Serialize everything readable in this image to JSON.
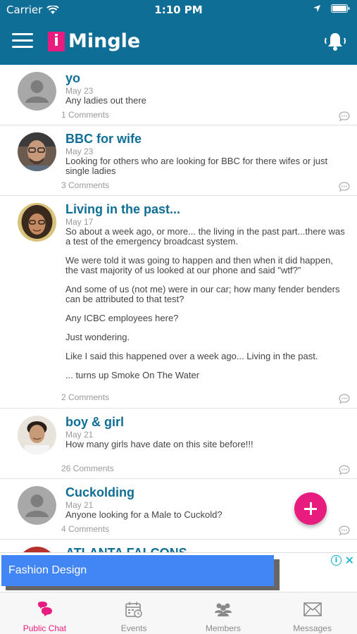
{
  "status_bar": {
    "carrier": "Carrier",
    "time": "1:10 PM"
  },
  "header": {
    "logo_letter": "i",
    "app_name": "Mingle"
  },
  "posts": [
    {
      "title": "yo",
      "date": "May 23",
      "body": [
        "Any ladies out there"
      ],
      "comments": "1 Comments",
      "avatar": "default-avatar"
    },
    {
      "title": "BBC for wife",
      "date": "May 23",
      "body": [
        "Looking for others who are looking for BBC for there wifes or just single ladies"
      ],
      "comments": "3 Comments",
      "avatar": "photo-man-glasses"
    },
    {
      "title": "Living in the past...",
      "date": "May 17",
      "body": [
        "So about a week ago, or more... the living in the past part...there was a test of the emergency broadcast system.",
        "We were told it was going to happen and then when it did happen, the vast majority of us looked at our phone and said \"wtf?\"",
        "And some of us (not me) were in our car; how many fender benders can be attributed to that test?",
        "Any ICBC employees here?",
        "Just wondering.",
        "Like I said this happened over a week ago... Living in the past.",
        "... turns up Smoke On The Water"
      ],
      "comments": "2 Comments",
      "avatar": "photo-curly-hair"
    },
    {
      "title": "boy & girl",
      "date": "May 21",
      "body": [
        "How many girls have date on this site before!!!"
      ],
      "comments": "26 Comments",
      "avatar": "photo-young-man"
    },
    {
      "title": "Cuckolding",
      "date": "May 21",
      "body": [
        "Anyone looking for a Male to Cuckold?"
      ],
      "comments": "4 Comments",
      "avatar": "default-avatar"
    },
    {
      "title": "ATLANTA FALCONS",
      "date": "",
      "body": [],
      "comments": "",
      "avatar": "photo-partial"
    }
  ],
  "ad": {
    "label": "Fashion Design",
    "info_icon": "i",
    "close_icon": "✕"
  },
  "tabs": [
    {
      "label": "Public Chat",
      "icon": "chat-bubbles-icon",
      "active": true
    },
    {
      "label": "Events",
      "icon": "calendar-icon",
      "active": false
    },
    {
      "label": "Members",
      "icon": "members-icon",
      "active": false
    },
    {
      "label": "Messages",
      "icon": "envelope-icon",
      "active": false
    }
  ],
  "colors": {
    "primary": "#0f6e96",
    "accent": "#e81c7f",
    "ad_blue": "#4285f4"
  }
}
